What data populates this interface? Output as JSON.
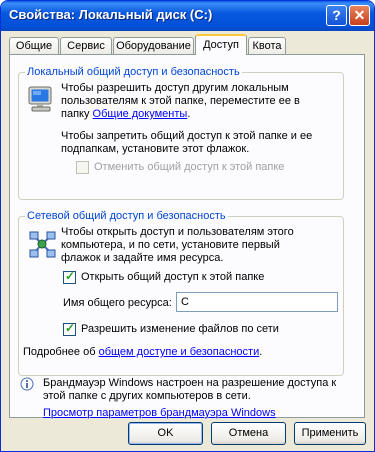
{
  "window": {
    "title": "Свойства: Локальный диск (C:)",
    "help_label": "?",
    "close_label": "✕"
  },
  "tabs": [
    {
      "label": "Общие"
    },
    {
      "label": "Сервис"
    },
    {
      "label": "Оборудование"
    },
    {
      "label": "Доступ",
      "active": true
    },
    {
      "label": "Квота"
    }
  ],
  "local_sharing": {
    "legend": "Локальный общий доступ и безопасность",
    "line1": "Чтобы разрешить доступ другим локальным",
    "line2": "пользователям к этой папке, переместите ее в",
    "line3_prefix": "папку ",
    "line3_link": "Общие документы",
    "line3_suffix": ".",
    "line4": "Чтобы запретить общий доступ к этой папке и ее",
    "line5": "подпапкам, установите этот флажок.",
    "checkbox_label": "Отменить общий доступ к этой папке",
    "checkbox_checked": false,
    "checkbox_enabled": false
  },
  "network_sharing": {
    "legend": "Сетевой общий доступ и безопасность",
    "line1": "Чтобы открыть доступ и пользователям этого",
    "line2": "компьютера, и по сети, установите первый",
    "line3": "флажок и задайте имя ресурса.",
    "share_checkbox_label": "Открыть общий доступ к этой папке",
    "share_checked": true,
    "share_name_label": "Имя общего ресурса:",
    "share_name_value": "C",
    "allow_changes_label": "Разрешить изменение файлов по сети",
    "allow_changes_checked": true,
    "more_prefix": "Подробнее об ",
    "more_link": "общем доступе и безопасности",
    "more_suffix": "."
  },
  "firewall": {
    "line1": "Брандмауэр Windows настроен на разрешение доступа к",
    "line2": "этой папке с других компьютеров в сети.",
    "link": "Просмотр параметров брандмауэра Windows"
  },
  "buttons": {
    "ok": "OK",
    "cancel": "Отмена",
    "apply": "Применить"
  }
}
